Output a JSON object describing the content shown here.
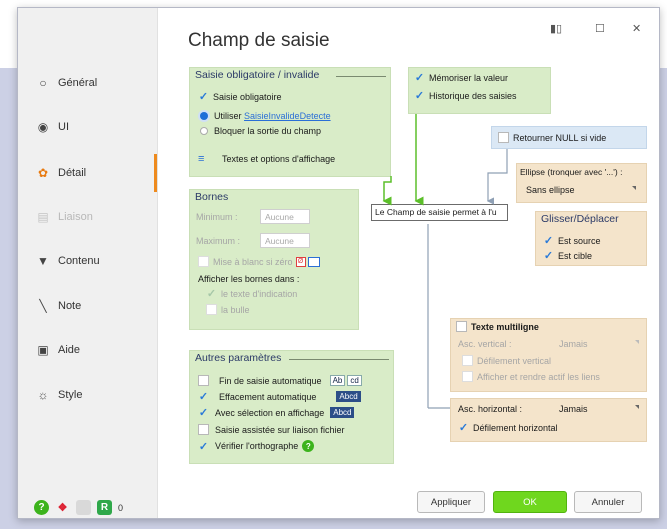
{
  "window": {
    "title": "Champ de saisie"
  },
  "sidebar": {
    "items": [
      {
        "label": "Général",
        "icon": "circle-o-icon",
        "state": "normal"
      },
      {
        "label": "UI",
        "icon": "eye-icon",
        "state": "normal"
      },
      {
        "label": "Détail",
        "icon": "gear-icon",
        "state": "active"
      },
      {
        "label": "Liaison",
        "icon": "link-icon",
        "state": "disabled"
      },
      {
        "label": "Contenu",
        "icon": "tool-icon",
        "state": "normal"
      },
      {
        "label": "Note",
        "icon": "pen-icon",
        "state": "normal"
      },
      {
        "label": "Aide",
        "icon": "help-book-icon",
        "state": "normal"
      },
      {
        "label": "Style",
        "icon": "palette-icon",
        "state": "normal"
      }
    ],
    "bottom_count": "0"
  },
  "saisie": {
    "title": "Saisie obligatoire / invalide",
    "obligatoire": "Saisie obligatoire",
    "utiliser": "Utiliser",
    "utiliser_link": "SaisieInvalideDetecte",
    "bloquer": "Bloquer la sortie du champ",
    "textes_options": "Textes et options d'affichage"
  },
  "memo": {
    "memoriser": "Mémoriser la valeur",
    "historique": "Historique des saisies"
  },
  "retourner_null": "Retourner NULL si vide",
  "ellipse": {
    "label": "Ellipse (tronquer avec '...') :",
    "value": "Sans ellipse"
  },
  "glisser": {
    "title": "Glisser/Déplacer",
    "source": "Est source",
    "cible": "Est cible"
  },
  "preview_text": "Le Champ de saisie permet à l'u",
  "bornes": {
    "title": "Bornes",
    "minimum": "Minimum :",
    "maximum": "Maximum :",
    "aucune_min": "Aucune",
    "aucune_max": "Aucune",
    "mise_blanc": "Mise à blanc si zéro",
    "afficher_dans": "Afficher les bornes dans :",
    "texte_indication": "le texte d'indication",
    "bulle": "la bulle"
  },
  "autres": {
    "title": "Autres paramètres",
    "fin_saisie": "Fin de saisie automatique",
    "effacement": "Effacement automatique",
    "avec_selection": "Avec sélection en affichage",
    "saisie_assistee": "Saisie assistée sur liaison fichier",
    "verifier": "Vérifier l'orthographe",
    "chip_abc": "Ab",
    "chip_cd": "cd",
    "chip_abcd": "Abcd"
  },
  "multiligne": {
    "title": "Texte multiligne",
    "asc_vertical": "Asc. vertical :",
    "asc_vertical_value": "Jamais",
    "defilement_vertical": "Défilement vertical",
    "afficher_liens": "Afficher et rendre actif les liens"
  },
  "horizontal": {
    "label": "Asc. horizontal :",
    "value": "Jamais",
    "defilement": "Défilement horizontal"
  },
  "buttons": {
    "appliquer": "Appliquer",
    "ok": "OK",
    "annuler": "Annuler"
  },
  "colors": {
    "accent": "#ee8a1d",
    "ok_green": "#6fd71e",
    "group_green": "#d9ecc8",
    "group_blue": "#dbe8f5",
    "group_beige": "#f4e4cb",
    "link_blue": "#2b6fd6"
  }
}
